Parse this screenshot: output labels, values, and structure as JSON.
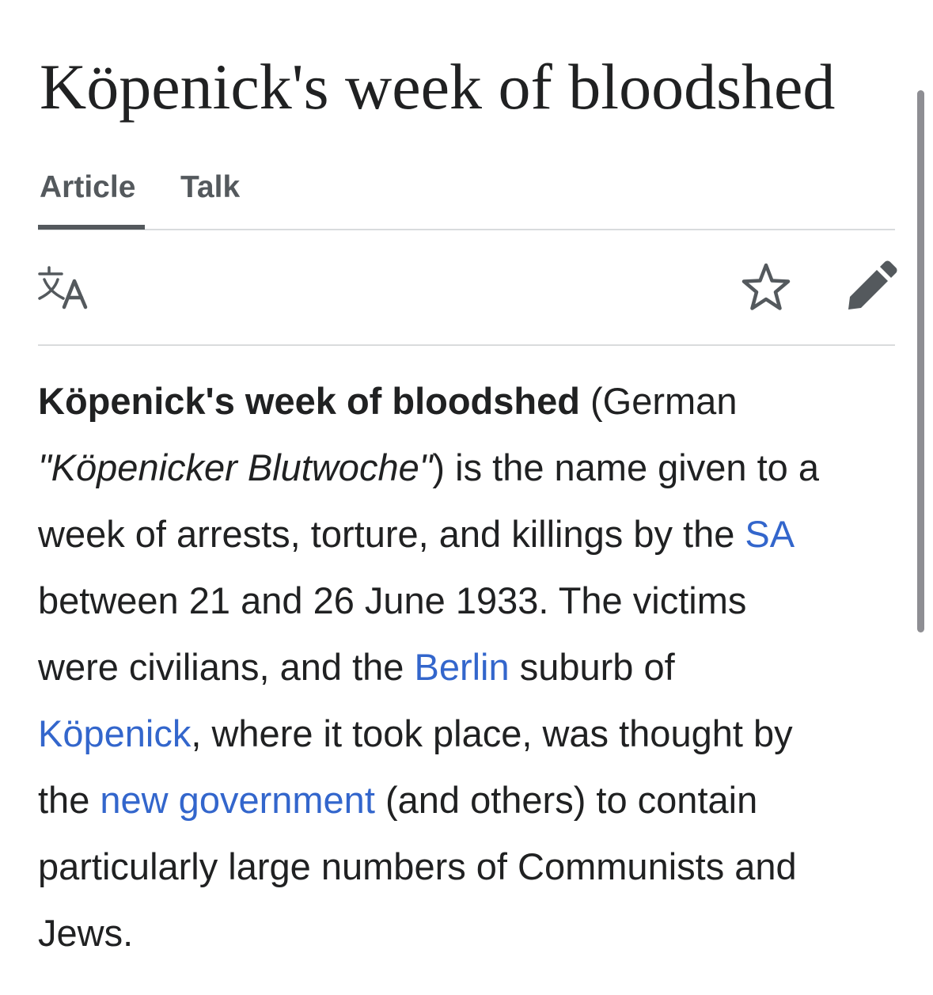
{
  "article": {
    "title": "Köpenick's week of bloodshed"
  },
  "tabs": {
    "article": "Article",
    "talk": "Talk"
  },
  "toolbar": {
    "language_icon": "translate-icon",
    "watch_icon": "star-icon",
    "edit_icon": "pencil-icon"
  },
  "colors": {
    "text": "#202122",
    "link": "#3366cc",
    "tab_text": "#54595d",
    "divider": "#d9dbdd"
  },
  "lead": {
    "l1_bold": "Köpenick's week of bloodshed",
    "l1_rest": " (German",
    "l2_italic": "\"Köpenicker Blutwoche\"",
    "l2_rest": ") is the name given to a",
    "l3_pre": "week of arrests, torture, and killings by the ",
    "l3_link_sa": "SA",
    "l4": "between 21 and 26 June 1933. The victims",
    "l5_pre": "were civilians, and the ",
    "l5_link_berlin": "Berlin",
    "l5_post": " suburb of",
    "l6_link_kopenick": "Köpenick",
    "l6_post": ", where it took place, was thought by",
    "l7_pre": "the ",
    "l7_link_newgov": "new government",
    "l7_post": " (and others) to contain",
    "l8": "particularly large numbers of Communists and",
    "l9": "Jews."
  }
}
